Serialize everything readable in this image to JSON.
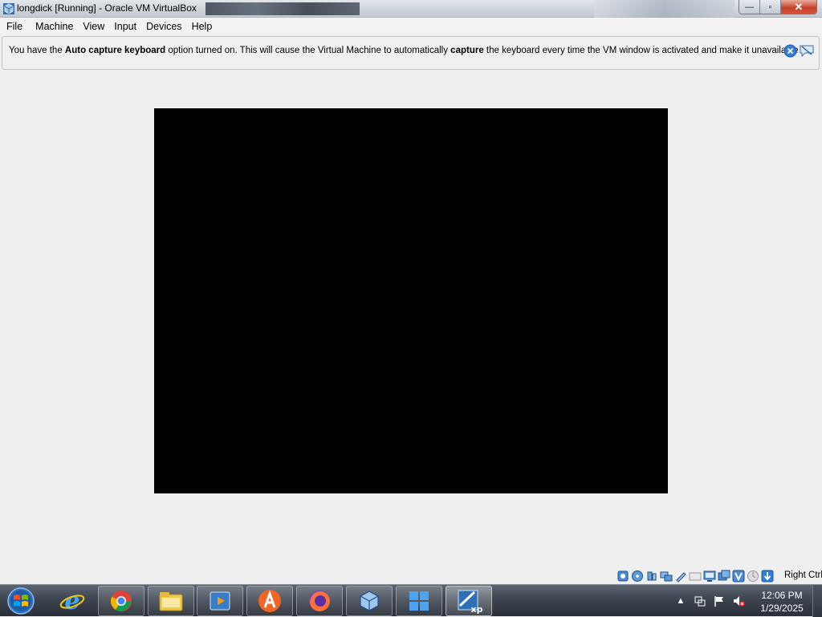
{
  "window": {
    "title": "longdick [Running] - Oracle VM VirtualBox",
    "controls": {
      "minimize": "—",
      "maximize": "▫",
      "close": "✕"
    }
  },
  "menubar": {
    "items": [
      "File",
      "Machine",
      "View",
      "Input",
      "Devices",
      "Help"
    ]
  },
  "banner": {
    "text_1": "You have the ",
    "bold_1": "Auto capture keyboard",
    "text_2": " option turned on. This will cause the Virtual Machine to automatically ",
    "bold_2": "capture",
    "text_3": " the keyboard every time the VM window is activated and make it unavailable to"
  },
  "statusbar": {
    "icons": [
      "hard-disk-icon",
      "optical-drive-icon",
      "audio-icon",
      "network-icon",
      "usb-icon",
      "shared-folders-icon",
      "display-icon",
      "video-capture-icon",
      "virtualization-icon",
      "mouse-integration-icon",
      "keyboard-capture-icon"
    ],
    "host_key": "Right Ctrl"
  },
  "taskbar": {
    "apps": [
      "internet-explorer",
      "chrome-browser",
      "file-explorer",
      "media-player",
      "avast",
      "firefox",
      "virtualbox-manager",
      "windows-app",
      "virtualbox-xp-vm"
    ],
    "clock_time": "12:06 PM",
    "clock_date": "1/29/2025"
  },
  "colors": {
    "vm_screen": "#000000",
    "taskbar": "#3d4550",
    "window_bg": "#efefef"
  }
}
